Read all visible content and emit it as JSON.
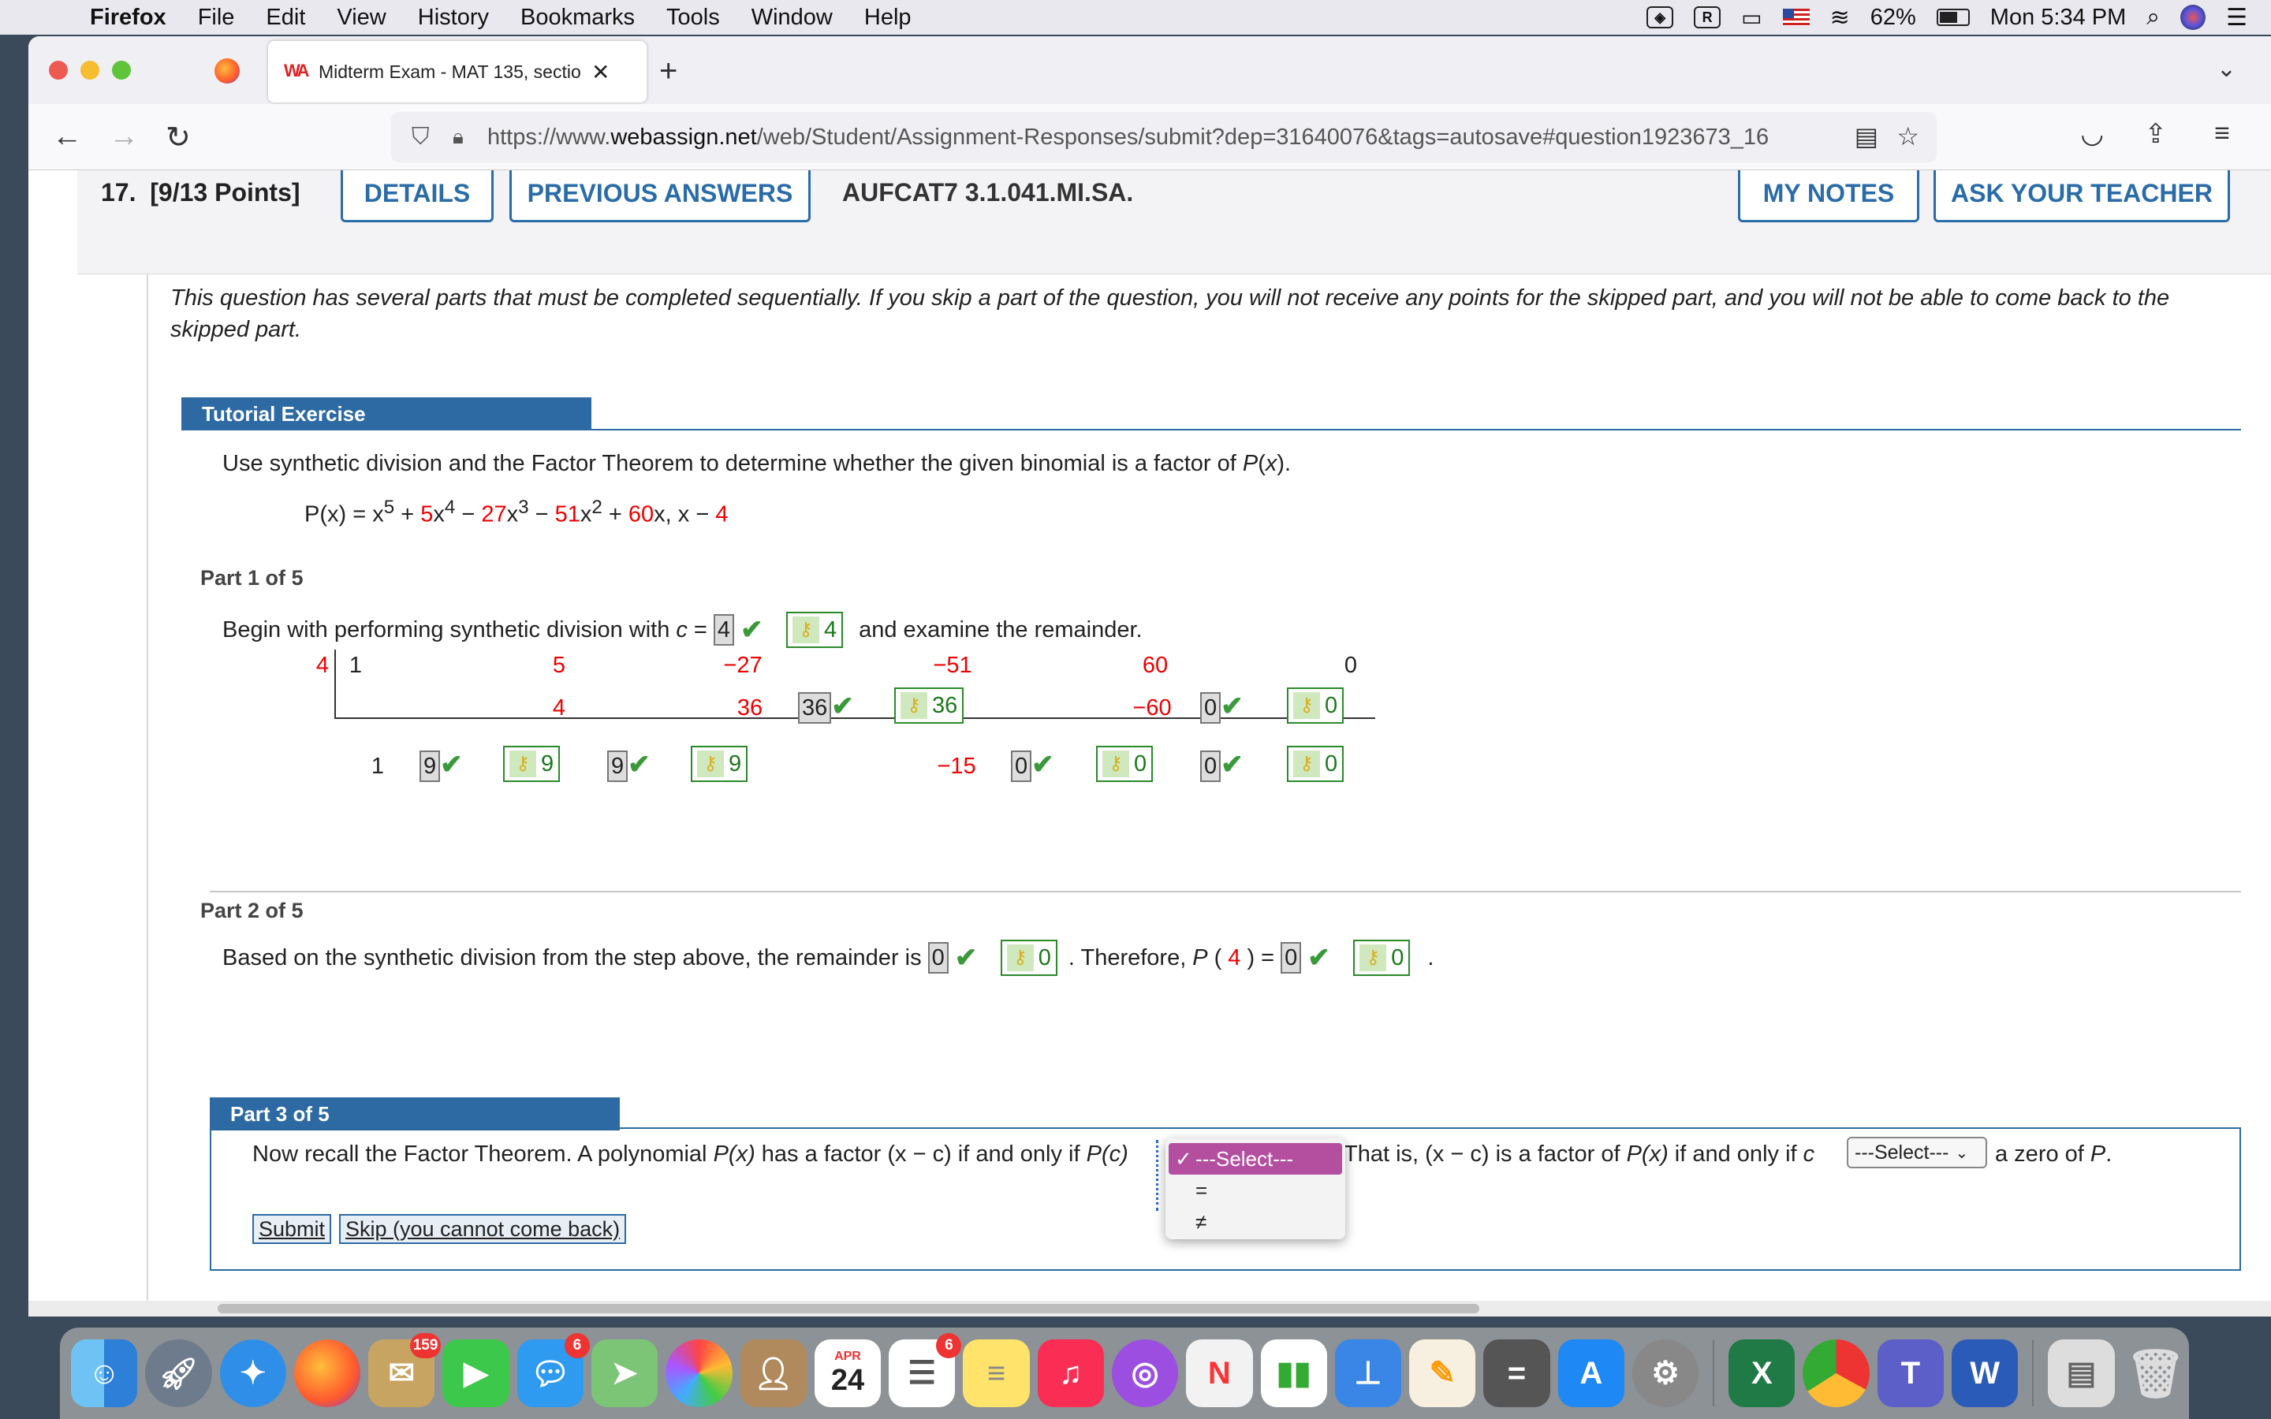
{
  "menubar": {
    "app": "Firefox",
    "items": [
      "File",
      "Edit",
      "View",
      "History",
      "Bookmarks",
      "Tools",
      "Window",
      "Help"
    ],
    "battery": "62%",
    "clock": "Mon 5:34 PM"
  },
  "browser": {
    "tab_title": "Midterm Exam - MAT 135, sectio",
    "url_prefix": "https://www.",
    "url_domain": "webassign.net",
    "url_rest": "/web/Student/Assignment-Responses/submit?dep=31640076&tags=autosave#question1923673_16"
  },
  "question": {
    "number": "17.",
    "points": "[9/13 Points]",
    "details_label": "DETAILS",
    "previous_answers_label": "PREVIOUS ANSWERS",
    "code": "AUFCAT7 3.1.041.MI.SA.",
    "my_notes_label": "MY NOTES",
    "ask_teacher_label": "ASK YOUR TEACHER",
    "intro": "This question has several parts that must be completed sequentially. If you skip a part of the question, you will not receive any points for the skipped part, and you will not be able to come back to the skipped part."
  },
  "tutorial": {
    "header": "Tutorial Exercise",
    "instruction_a": "Use synthetic division and the Factor Theorem to determine whether the given binomial is a factor of ",
    "instruction_b": "P",
    "instruction_c": "(",
    "instruction_d": "x",
    "instruction_e": ").",
    "poly": {
      "lhs": "P(x) = x",
      "e5": "5",
      "plus1": " + ",
      "c5": "5",
      "x4": "x",
      "e4": "4",
      "minus1": " − ",
      "c27": "27",
      "x3": "x",
      "e3": "3",
      "minus2": " − ",
      "c51": "51",
      "x2": "x",
      "e2": "2",
      "plus2": " + ",
      "c60": "60",
      "x1": "x,  x − ",
      "c4": "4"
    }
  },
  "part1": {
    "label": "Part 1 of 5",
    "text_a": "Begin with performing synthetic division with ",
    "text_c": "c",
    "text_eq": " = ",
    "c_value": "4",
    "c_key": "4",
    "text_b": "and examine the remainder.",
    "divisor": "4",
    "row1": [
      "1",
      "5",
      "−27",
      "−51",
      "60",
      "0"
    ],
    "row2": [
      "4",
      "36",
      "36",
      "36",
      "−60",
      "0",
      "0"
    ],
    "row3": [
      "1",
      "9",
      "9",
      "9",
      "9",
      "−15",
      "0",
      "0",
      "0",
      "0"
    ]
  },
  "part2": {
    "label": "Part 2 of 5",
    "text_a": "Based on the synthetic division from the step above, the remainder is",
    "remainder": "0",
    "remainder_key": "0",
    "text_b": ". Therefore, ",
    "p": "P",
    "p_open": "(",
    "p_arg": "4",
    "p_close": ") =",
    "p_value": "0",
    "p_key": "0",
    "end": "."
  },
  "part3": {
    "label": "Part 3 of 5",
    "text_a": "Now recall the Factor Theorem. A polynomial ",
    "text_b": "P(x)",
    "text_c": " has a factor (x − c) if and only if ",
    "text_d": "P(c)",
    "text_e": "That is, (x − c) is a factor of ",
    "text_f": "P(x)",
    "text_g": " if and only if ",
    "text_h": "c",
    "text_i": "a zero of ",
    "text_j": "P",
    "text_k": ".",
    "select2": "---Select---",
    "dropdown_options": [
      "---Select---",
      "=",
      "≠"
    ],
    "dropdown_tick": "✓",
    "submit_label": "Submit",
    "skip_label": "Skip (you cannot come back)"
  },
  "dock": {
    "badges": {
      "mail": "159",
      "messages": "6",
      "reminders": "6"
    },
    "calendar_month": "APR",
    "calendar_day": "24"
  },
  "colors": {
    "accent_blue": "#2d6aa3",
    "correct_green": "#2a8a2a",
    "coefficient_red": "#e00000",
    "select_highlight": "#b44fa0"
  }
}
